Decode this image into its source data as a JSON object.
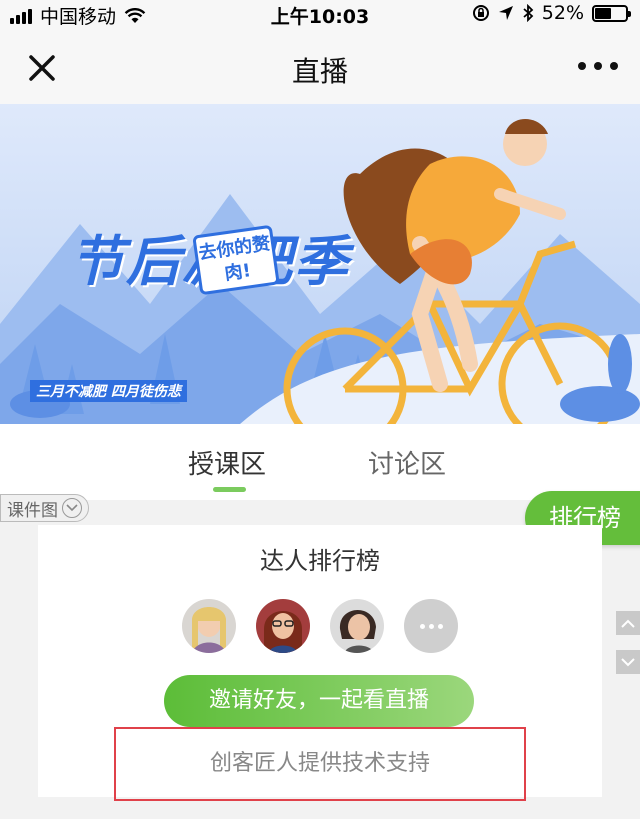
{
  "status_bar": {
    "carrier": "中国移动",
    "time": "上午10:03",
    "battery_percent": "52%",
    "battery_level": 0.52
  },
  "nav": {
    "title": "直播",
    "close_icon": "close-icon",
    "more_icon": "more-icon"
  },
  "banner": {
    "title": "节后减肥季",
    "badge": "去你的赘肉!",
    "subtitle_left": "三月不减肥",
    "subtitle_right": "四月徒伤悲"
  },
  "tabs": [
    {
      "label": "授课区",
      "active": true
    },
    {
      "label": "讨论区",
      "active": false
    }
  ],
  "slide_select": {
    "label": "课件图"
  },
  "rank_button": {
    "label": "排行榜"
  },
  "card": {
    "title": "达人排行榜",
    "avatars": [
      "avatar-1",
      "avatar-2",
      "avatar-3"
    ],
    "invite_label": "邀请好友，一起看直播",
    "support_text": "创客匠人提供技术支持"
  },
  "colors": {
    "accent_green": "#64be3b",
    "banner_blue": "#2f6fdf",
    "highlight_red": "#e0414a"
  }
}
